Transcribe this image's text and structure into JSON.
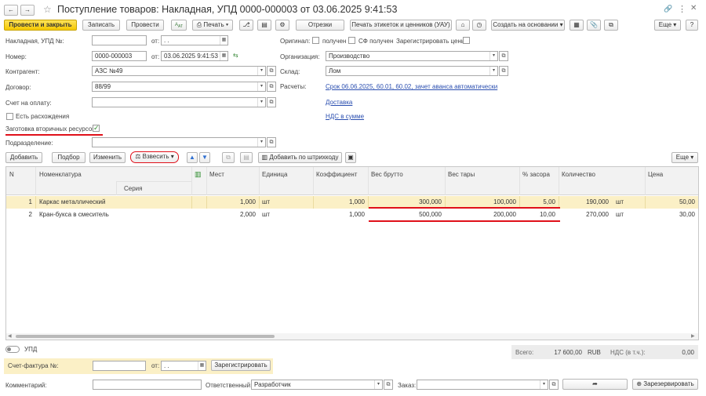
{
  "window": {
    "title": "Поступление товаров: Накладная, УПД 0000-000003 от 03.06.2025 9:41:53"
  },
  "nav": {
    "back": "←",
    "forward": "→",
    "star": "☆",
    "link": "🔗",
    "more": "⋮",
    "close": "✕"
  },
  "toolbar": {
    "post_close": "Провести и закрыть",
    "save": "Записать",
    "post": "Провести",
    "print": "Печать",
    "cuts": "Отрезки",
    "print_labels": "Печать этикеток и ценников (УАУ)",
    "create_basis": "Создать на основании",
    "more": "Еще",
    "help": "?"
  },
  "form": {
    "invoice_label": "Накладная, УПД №:",
    "invoice_value": "",
    "from1_label": "от:",
    "from1_value": ". .",
    "number_label": "Номер:",
    "number_value": "0000-000003",
    "from2_label": "от:",
    "from2_value": "03.06.2025  9:41:53",
    "contractor_label": "Контрагент:",
    "contractor_value": "АЗС №49",
    "contract_label": "Договор:",
    "contract_value": "88/99",
    "payment_label": "Счет на оплату:",
    "payment_value": "",
    "discrepancy_label": "Есть расхождения",
    "secondary_label": "Заготовка вторичных ресурсов:",
    "subdivision_label": "Подразделение:",
    "subdivision_value": "",
    "original_label": "Оригинал:",
    "received_label": "получен",
    "sf_received_label": "СФ получен",
    "register_prices_label": "Зарегистрировать цены:",
    "org_label": "Организация:",
    "org_value": "Производство",
    "warehouse_label": "Склад:",
    "warehouse_value": "Лом",
    "settlements_label": "Расчеты:",
    "settlements_link": "Срок 06.06.2025, 60.01, 60.02, зачет аванса автоматически",
    "delivery_link": "Доставка",
    "vat_link": "НДС в сумме"
  },
  "table_toolbar": {
    "add": "Добавить",
    "select": "Подбор",
    "change": "Изменить",
    "weigh": "Взвесить",
    "add_barcode": "Добавить по штрихкоду",
    "more": "Еще"
  },
  "table": {
    "columns": {
      "n": "N",
      "nomenclature": "Номенклатура",
      "series": "Серия",
      "places": "Мест",
      "unit": "Единица",
      "coef": "Коэффициент",
      "gross": "Вес брутто",
      "tare": "Вес тары",
      "trash": "% засора",
      "qty": "Количество",
      "price": "Цена"
    },
    "rows": [
      {
        "n": "1",
        "nom": "Каркас металлический",
        "places": "1,000",
        "unit": "шт",
        "coef": "1,000",
        "gross": "300,000",
        "tare": "100,000",
        "trash": "5,00",
        "qty": "190,000",
        "qty_unit": "шт",
        "price": "50,00"
      },
      {
        "n": "2",
        "nom": "Кран-букса в смеситель",
        "places": "2,000",
        "unit": "шт",
        "coef": "1,000",
        "gross": "500,000",
        "tare": "200,000",
        "trash": "10,00",
        "qty": "270,000",
        "qty_unit": "шт",
        "price": "30,00"
      }
    ]
  },
  "footer": {
    "upd_label": "УПД",
    "total_label": "Всего:",
    "total_value": "17 600,00",
    "currency": "RUB",
    "vat_label": "НДС (в т.ч.):",
    "vat_value": "0,00",
    "sf_label": "Счет-фактура №:",
    "sf_value": "",
    "sf_from_label": "от:",
    "sf_from_value": ". .",
    "register": "Зарегистрировать",
    "comment_label": "Комментарий:",
    "comment_value": "",
    "responsible_label": "Ответственный:",
    "responsible_value": "Разработчик",
    "order_label": "Заказ:",
    "order_value": "",
    "reserve": "Зарезервировать"
  },
  "colors": {
    "accent": "#f5c800",
    "highlight_row": "#fbf0c6",
    "red_mark": "#e0101a",
    "link": "#2b4fb0"
  }
}
